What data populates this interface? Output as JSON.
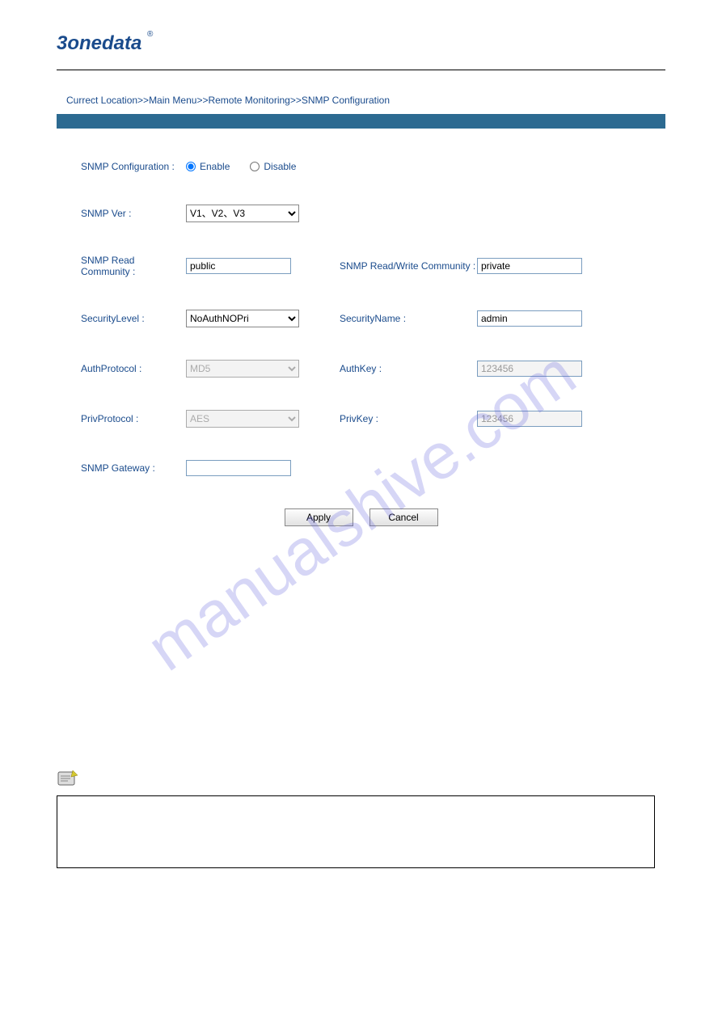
{
  "logo": {
    "text": "3onedata",
    "reg": "®"
  },
  "breadcrumb": {
    "curloc": "Currect Location",
    "sep": ">>",
    "main": "Main Menu",
    "remote": "Remote Monitoring",
    "snmp": "SNMP Configuration"
  },
  "form": {
    "snmp_config_label": "SNMP Configuration :",
    "enable_label": "Enable",
    "disable_label": "Disable",
    "snmp_ver_label": "SNMP Ver :",
    "snmp_ver_value": "V1、V2、V3",
    "read_community_label": "SNMP Read Community :",
    "read_community_value": "public",
    "rw_community_label": "SNMP Read/Write Community :",
    "rw_community_value": "private",
    "security_level_label": "SecurityLevel :",
    "security_level_value": "NoAuthNOPri",
    "security_name_label": "SecurityName :",
    "security_name_value": "admin",
    "auth_protocol_label": "AuthProtocol :",
    "auth_protocol_value": "MD5",
    "auth_key_label": "AuthKey :",
    "auth_key_value": "123456",
    "priv_protocol_label": "PrivProtocol :",
    "priv_protocol_value": "AES",
    "priv_key_label": "PrivKey :",
    "priv_key_value": "123456",
    "gateway_label": "SNMP Gateway :",
    "gateway_value": ""
  },
  "buttons": {
    "apply": "Apply",
    "cancel": "Cancel"
  },
  "watermark": "manualshive.com"
}
